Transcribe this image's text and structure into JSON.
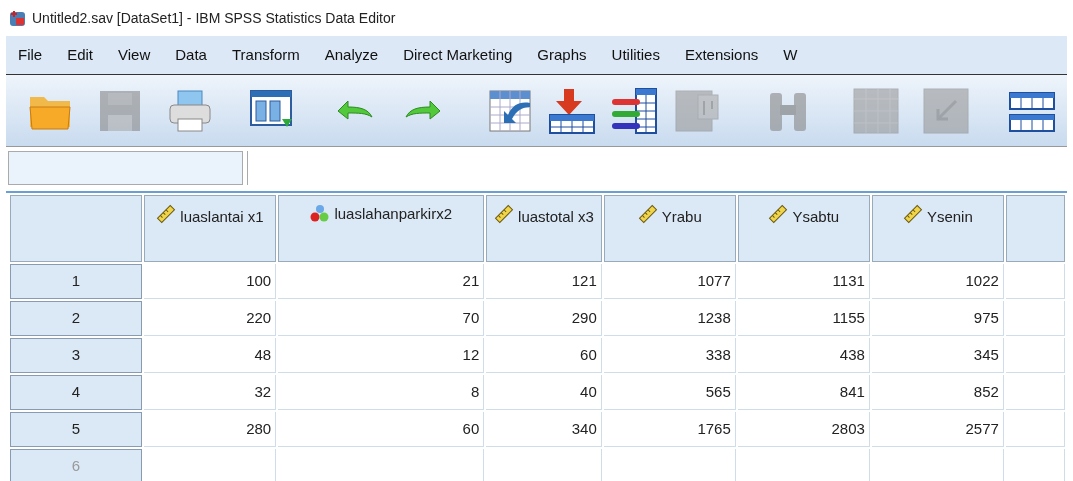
{
  "window": {
    "title": "Untitled2.sav [DataSet1] - IBM SPSS Statistics Data Editor"
  },
  "menu": [
    "File",
    "Edit",
    "View",
    "Data",
    "Transform",
    "Analyze",
    "Direct Marketing",
    "Graphs",
    "Utilities",
    "Extensions",
    "W"
  ],
  "toolbar": [
    {
      "kind": "open",
      "disabled": false
    },
    {
      "kind": "save",
      "disabled": true
    },
    {
      "kind": "print",
      "disabled": false
    },
    {
      "kind": "recall",
      "disabled": false
    },
    {
      "kind": "undo",
      "disabled": false
    },
    {
      "kind": "redo",
      "disabled": false
    },
    {
      "kind": "goto",
      "disabled": false
    },
    {
      "kind": "insert-case",
      "disabled": false
    },
    {
      "kind": "insert-variable",
      "disabled": false
    },
    {
      "kind": "split",
      "disabled": true
    },
    {
      "kind": "find",
      "disabled": true
    },
    {
      "kind": "grid",
      "disabled": true
    },
    {
      "kind": "weight",
      "disabled": true
    },
    {
      "kind": "tables",
      "disabled": false
    }
  ],
  "table": {
    "columns": [
      {
        "name": "luaslantai x1",
        "kind": "scale"
      },
      {
        "name": "luaslahanparkirx2",
        "kind": "nominal"
      },
      {
        "name": "luastotal x3",
        "kind": "scale"
      },
      {
        "name": "Yrabu",
        "kind": "scale"
      },
      {
        "name": "Ysabtu",
        "kind": "scale"
      },
      {
        "name": "Ysenin",
        "kind": "scale"
      }
    ],
    "rows": [
      {
        "label": "1",
        "empty": false,
        "cells": [
          "100",
          "21",
          "121",
          "1077",
          "1131",
          "1022"
        ]
      },
      {
        "label": "2",
        "empty": false,
        "cells": [
          "220",
          "70",
          "290",
          "1238",
          "1155",
          "975"
        ]
      },
      {
        "label": "3",
        "empty": false,
        "cells": [
          "48",
          "12",
          "60",
          "338",
          "438",
          "345"
        ]
      },
      {
        "label": "4",
        "empty": false,
        "cells": [
          "32",
          "8",
          "40",
          "565",
          "841",
          "852"
        ]
      },
      {
        "label": "5",
        "empty": false,
        "cells": [
          "280",
          "60",
          "340",
          "1765",
          "2803",
          "2577"
        ]
      },
      {
        "label": "6",
        "empty": true,
        "cells": []
      }
    ]
  }
}
